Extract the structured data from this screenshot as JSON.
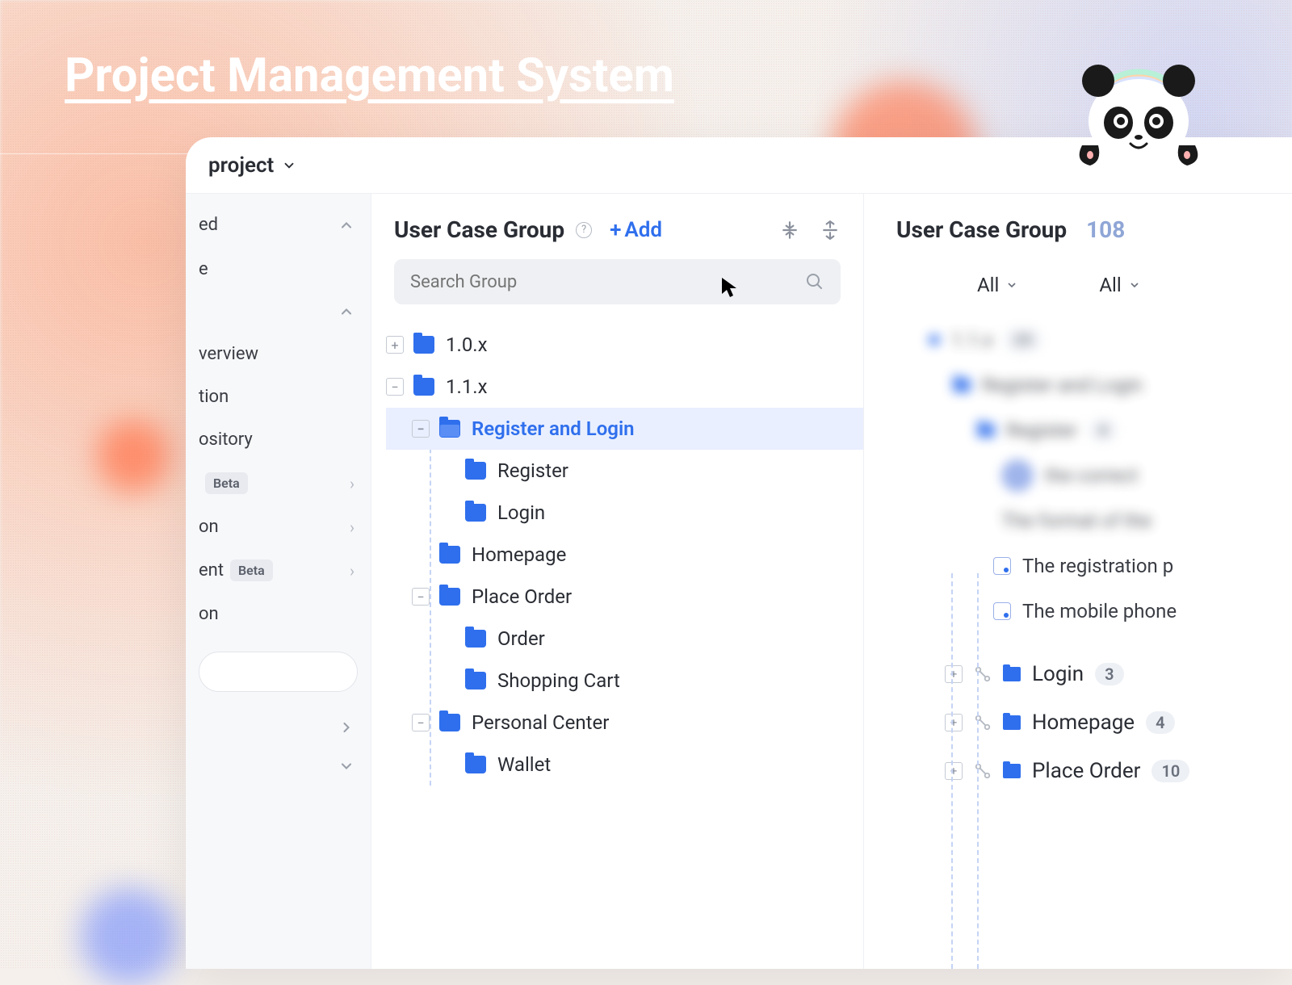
{
  "hero": {
    "title": "Project Management System"
  },
  "topbar": {
    "project_label": "project"
  },
  "sidebar": {
    "sections": [
      {
        "label": "ed",
        "chevron": "up"
      },
      {
        "label": "e"
      },
      {
        "label": "",
        "chevron": "up"
      }
    ],
    "items": [
      {
        "label": "verview"
      },
      {
        "label": "tion"
      },
      {
        "label": "ository"
      },
      {
        "label": "",
        "beta": "Beta",
        "chevron": true
      },
      {
        "label": "on",
        "chevron": true
      },
      {
        "label": "ent",
        "beta": "Beta",
        "chevron": true
      },
      {
        "label": "on"
      }
    ]
  },
  "center": {
    "title": "User Case Group",
    "add_label": "Add",
    "search_placeholder": "Search Group",
    "tree": {
      "n0": "1.0.x",
      "n1": "1.1.x",
      "n2": "Register and Login",
      "n2a": "Register",
      "n2b": "Login",
      "n3": "Homepage",
      "n4": "Place Order",
      "n4a": "Order",
      "n4b": "Shopping Cart",
      "n5": "Personal Center",
      "n5a": "Wallet"
    }
  },
  "right": {
    "title": "User Case Group",
    "count": "108",
    "filter_all": "All",
    "blurred": {
      "r0": "1.1.x",
      "r0_count": "25",
      "r1": "Register and Login",
      "r2": "Register",
      "r2_count": "4",
      "r3": "the correct",
      "r4": "The format of the"
    },
    "cases": {
      "c1": "The registration p",
      "c2": "The mobile phone"
    },
    "sections": {
      "s1": "Login",
      "s1_count": "3",
      "s2": "Homepage",
      "s2_count": "4",
      "s3": "Place Order",
      "s3_count": "10"
    }
  }
}
